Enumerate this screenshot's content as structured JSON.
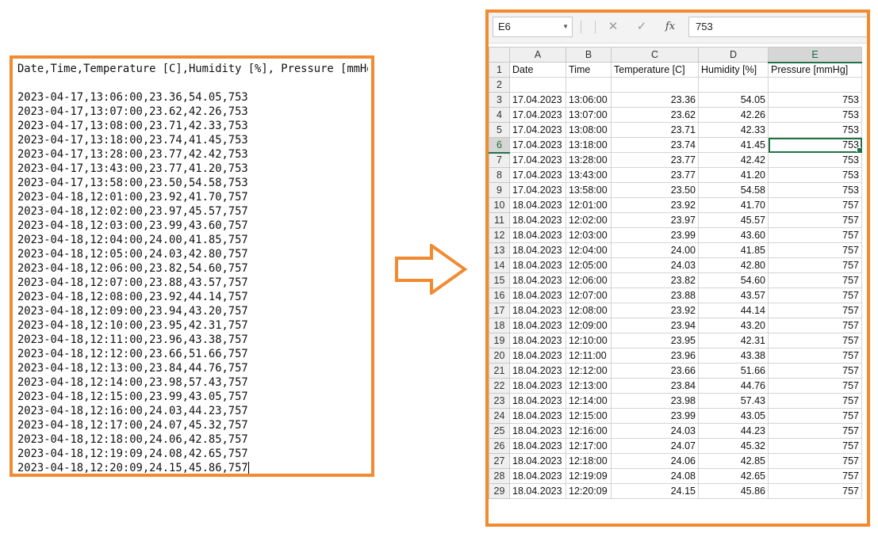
{
  "csv": {
    "lines": [
      "Date,Time,Temperature [C],Humidity [%], Pressure [mmHg]",
      "",
      "2023-04-17,13:06:00,23.36,54.05,753",
      "2023-04-17,13:07:00,23.62,42.26,753",
      "2023-04-17,13:08:00,23.71,42.33,753",
      "2023-04-17,13:18:00,23.74,41.45,753",
      "2023-04-17,13:28:00,23.77,42.42,753",
      "2023-04-17,13:43:00,23.77,41.20,753",
      "2023-04-17,13:58:00,23.50,54.58,753",
      "2023-04-18,12:01:00,23.92,41.70,757",
      "2023-04-18,12:02:00,23.97,45.57,757",
      "2023-04-18,12:03:00,23.99,43.60,757",
      "2023-04-18,12:04:00,24.00,41.85,757",
      "2023-04-18,12:05:00,24.03,42.80,757",
      "2023-04-18,12:06:00,23.82,54.60,757",
      "2023-04-18,12:07:00,23.88,43.57,757",
      "2023-04-18,12:08:00,23.92,44.14,757",
      "2023-04-18,12:09:00,23.94,43.20,757",
      "2023-04-18,12:10:00,23.95,42.31,757",
      "2023-04-18,12:11:00,23.96,43.38,757",
      "2023-04-18,12:12:00,23.66,51.66,757",
      "2023-04-18,12:13:00,23.84,44.76,757",
      "2023-04-18,12:14:00,23.98,57.43,757",
      "2023-04-18,12:15:00,23.99,43.05,757",
      "2023-04-18,12:16:00,24.03,44.23,757",
      "2023-04-18,12:17:00,24.07,45.32,757",
      "2023-04-18,12:18:00,24.06,42.85,757",
      "2023-04-18,12:19:09,24.08,42.65,757",
      "2023-04-18,12:20:09,24.15,45.86,757"
    ]
  },
  "spreadsheet": {
    "name_box": "E6",
    "formula_value": "753",
    "buttons": {
      "cancel": "✕",
      "enter": "✓",
      "fx": "fx"
    },
    "column_headers": [
      "A",
      "B",
      "C",
      "D",
      "E"
    ],
    "selected_column": "E",
    "selected_row": 6,
    "active_cell": {
      "row": 6,
      "col": 4
    },
    "rows": [
      {
        "n": 1,
        "cells": [
          "Date",
          "Time",
          "Temperature [C]",
          "Humidity [%]",
          "Pressure [mmHg]"
        ],
        "header": true
      },
      {
        "n": 2,
        "cells": [
          "",
          "",
          "",
          "",
          ""
        ]
      },
      {
        "n": 3,
        "cells": [
          "17.04.2023",
          "13:06:00",
          "23.36",
          "54.05",
          "753"
        ]
      },
      {
        "n": 4,
        "cells": [
          "17.04.2023",
          "13:07:00",
          "23.62",
          "42.26",
          "753"
        ]
      },
      {
        "n": 5,
        "cells": [
          "17.04.2023",
          "13:08:00",
          "23.71",
          "42.33",
          "753"
        ]
      },
      {
        "n": 6,
        "cells": [
          "17.04.2023",
          "13:18:00",
          "23.74",
          "41.45",
          "753"
        ]
      },
      {
        "n": 7,
        "cells": [
          "17.04.2023",
          "13:28:00",
          "23.77",
          "42.42",
          "753"
        ]
      },
      {
        "n": 8,
        "cells": [
          "17.04.2023",
          "13:43:00",
          "23.77",
          "41.20",
          "753"
        ]
      },
      {
        "n": 9,
        "cells": [
          "17.04.2023",
          "13:58:00",
          "23.50",
          "54.58",
          "753"
        ]
      },
      {
        "n": 10,
        "cells": [
          "18.04.2023",
          "12:01:00",
          "23.92",
          "41.70",
          "757"
        ]
      },
      {
        "n": 11,
        "cells": [
          "18.04.2023",
          "12:02:00",
          "23.97",
          "45.57",
          "757"
        ]
      },
      {
        "n": 12,
        "cells": [
          "18.04.2023",
          "12:03:00",
          "23.99",
          "43.60",
          "757"
        ]
      },
      {
        "n": 13,
        "cells": [
          "18.04.2023",
          "12:04:00",
          "24.00",
          "41.85",
          "757"
        ]
      },
      {
        "n": 14,
        "cells": [
          "18.04.2023",
          "12:05:00",
          "24.03",
          "42.80",
          "757"
        ]
      },
      {
        "n": 15,
        "cells": [
          "18.04.2023",
          "12:06:00",
          "23.82",
          "54.60",
          "757"
        ]
      },
      {
        "n": 16,
        "cells": [
          "18.04.2023",
          "12:07:00",
          "23.88",
          "43.57",
          "757"
        ]
      },
      {
        "n": 17,
        "cells": [
          "18.04.2023",
          "12:08:00",
          "23.92",
          "44.14",
          "757"
        ]
      },
      {
        "n": 18,
        "cells": [
          "18.04.2023",
          "12:09:00",
          "23.94",
          "43.20",
          "757"
        ]
      },
      {
        "n": 19,
        "cells": [
          "18.04.2023",
          "12:10:00",
          "23.95",
          "42.31",
          "757"
        ]
      },
      {
        "n": 20,
        "cells": [
          "18.04.2023",
          "12:11:00",
          "23.96",
          "43.38",
          "757"
        ]
      },
      {
        "n": 21,
        "cells": [
          "18.04.2023",
          "12:12:00",
          "23.66",
          "51.66",
          "757"
        ]
      },
      {
        "n": 22,
        "cells": [
          "18.04.2023",
          "12:13:00",
          "23.84",
          "44.76",
          "757"
        ]
      },
      {
        "n": 23,
        "cells": [
          "18.04.2023",
          "12:14:00",
          "23.98",
          "57.43",
          "757"
        ]
      },
      {
        "n": 24,
        "cells": [
          "18.04.2023",
          "12:15:00",
          "23.99",
          "43.05",
          "757"
        ]
      },
      {
        "n": 25,
        "cells": [
          "18.04.2023",
          "12:16:00",
          "24.03",
          "44.23",
          "757"
        ]
      },
      {
        "n": 26,
        "cells": [
          "18.04.2023",
          "12:17:00",
          "24.07",
          "45.32",
          "757"
        ]
      },
      {
        "n": 27,
        "cells": [
          "18.04.2023",
          "12:18:00",
          "24.06",
          "42.85",
          "757"
        ]
      },
      {
        "n": 28,
        "cells": [
          "18.04.2023",
          "12:19:09",
          "24.08",
          "42.65",
          "757"
        ]
      },
      {
        "n": 29,
        "cells": [
          "18.04.2023",
          "12:20:09",
          "24.15",
          "45.86",
          "757"
        ]
      }
    ]
  },
  "colors": {
    "accent": "#f28a30",
    "excel_green": "#217346"
  },
  "icons": {
    "arrow": "right-arrow-icon"
  }
}
